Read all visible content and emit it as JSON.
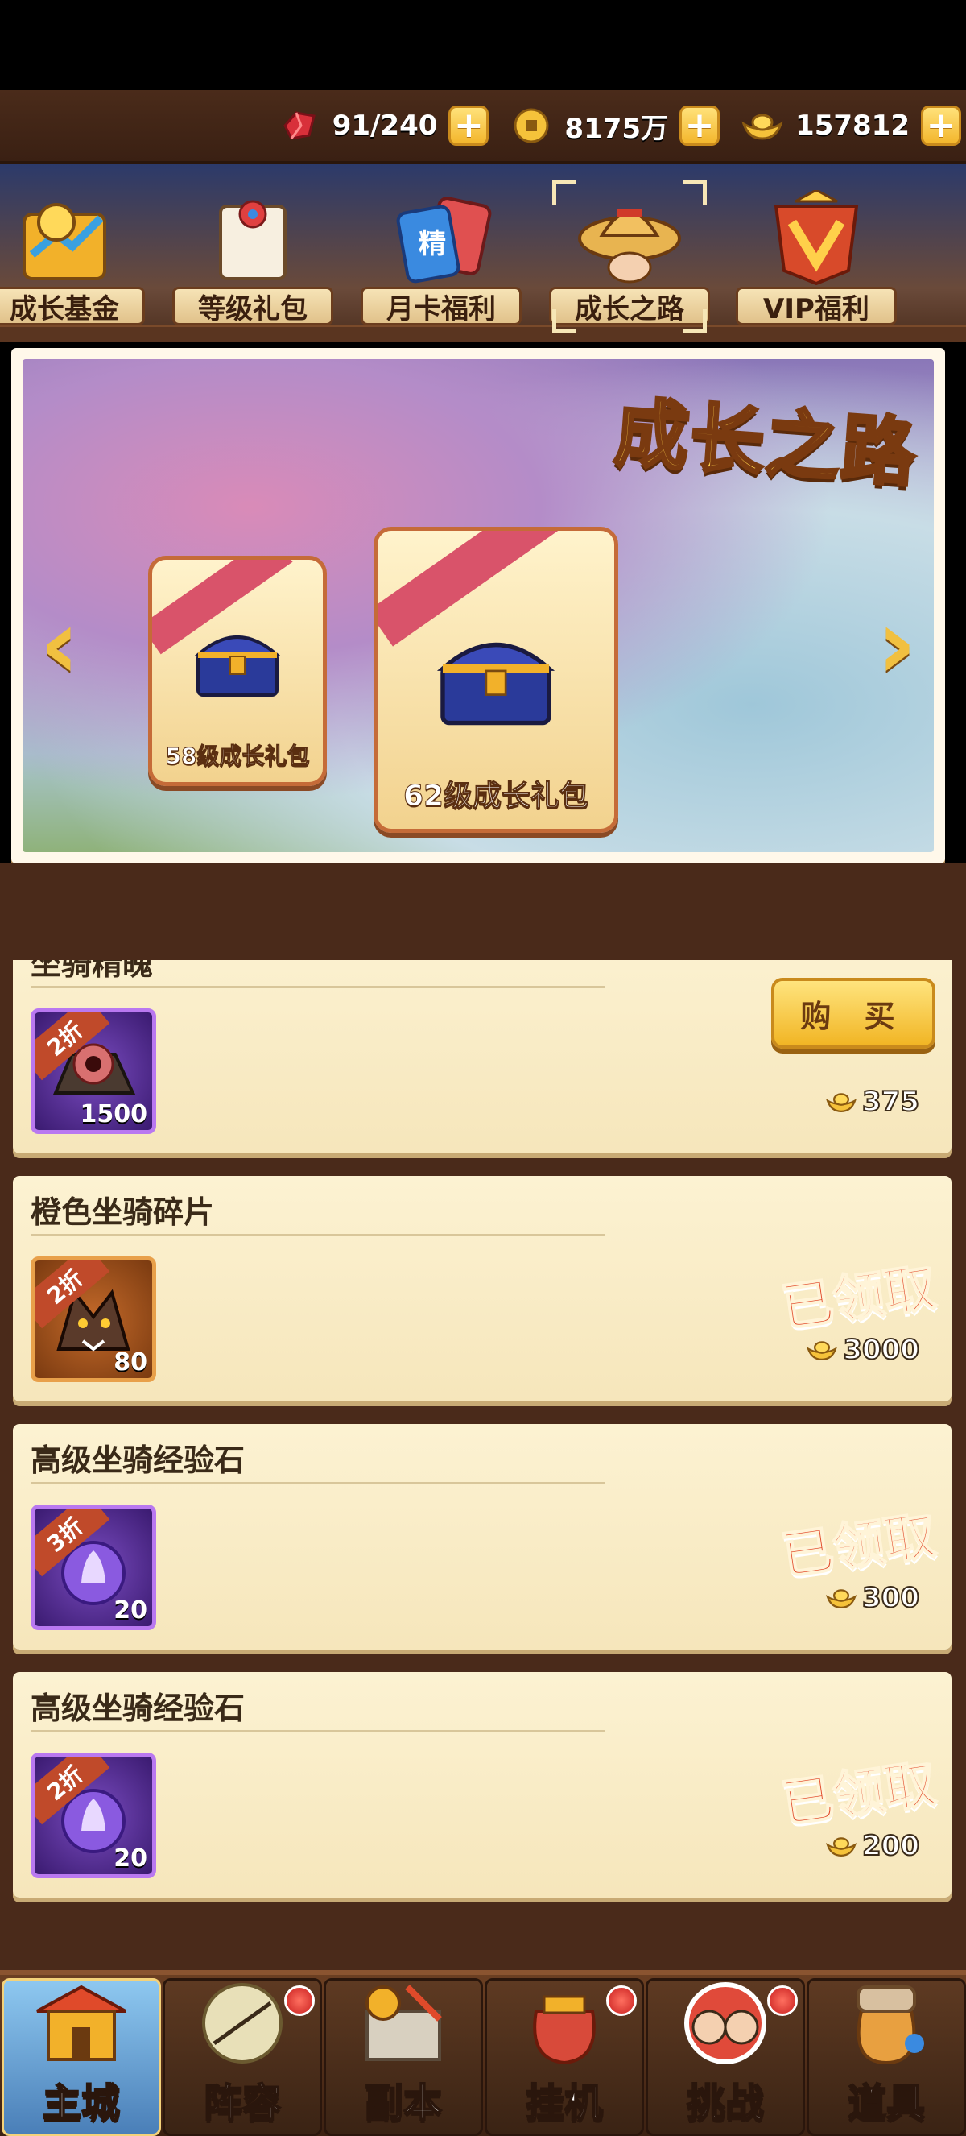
{
  "resources": [
    {
      "icon": "red-crystal-icon",
      "value": "91/240"
    },
    {
      "icon": "copper-coin-icon",
      "value": "8175万"
    },
    {
      "icon": "gold-ingot-icon",
      "value": "157812"
    }
  ],
  "tabs": [
    {
      "label": "成长基金",
      "icon": "growth-fund-icon"
    },
    {
      "label": "等级礼包",
      "icon": "scroll-icon"
    },
    {
      "label": "月卡福利",
      "icon": "month-card-icon",
      "badge": "精"
    },
    {
      "label": "成长之路",
      "icon": "growth-road-icon",
      "selected": true
    },
    {
      "label": "VIP福利",
      "icon": "vip-crest-icon"
    }
  ],
  "banner": {
    "title": "成长之路",
    "packs": [
      {
        "label": "58级成长礼包"
      },
      {
        "label": "62级成长礼包"
      }
    ]
  },
  "items": [
    {
      "title": "坐骑精魄",
      "discount": "2折",
      "count": "1500",
      "icon": "mount-soul-icon",
      "frame": "purple",
      "status": "buy",
      "action_label": "购 买",
      "price": "375"
    },
    {
      "title": "橙色坐骑碎片",
      "discount": "2折",
      "count": "80",
      "icon": "wolf-mount-shard-icon",
      "frame": "orange",
      "status": "claimed",
      "status_label": "已领取",
      "price": "3000"
    },
    {
      "title": "高级坐骑经验石",
      "discount": "3折",
      "count": "20",
      "icon": "purple-flame-orb-icon",
      "frame": "purple",
      "status": "claimed",
      "status_label": "已领取",
      "price": "300"
    },
    {
      "title": "高级坐骑经验石",
      "discount": "2折",
      "count": "20",
      "icon": "purple-flame-orb-icon",
      "frame": "purple",
      "status": "claimed",
      "status_label": "已领取",
      "price": "200"
    }
  ],
  "nav": [
    {
      "label": "主城",
      "active": true,
      "dot": false
    },
    {
      "label": "阵容",
      "active": false,
      "dot": true
    },
    {
      "label": "副本",
      "active": false,
      "dot": false
    },
    {
      "label": "挂机",
      "active": false,
      "dot": true
    },
    {
      "label": "挑战",
      "active": false,
      "dot": true
    },
    {
      "label": "道具",
      "active": false,
      "dot": false
    }
  ],
  "colors": {
    "accent_gold": "#f1b524",
    "claimed_red": "#e24a2a",
    "panel_cream": "#fcf2d2",
    "frame_brown": "#4a2a1a"
  }
}
